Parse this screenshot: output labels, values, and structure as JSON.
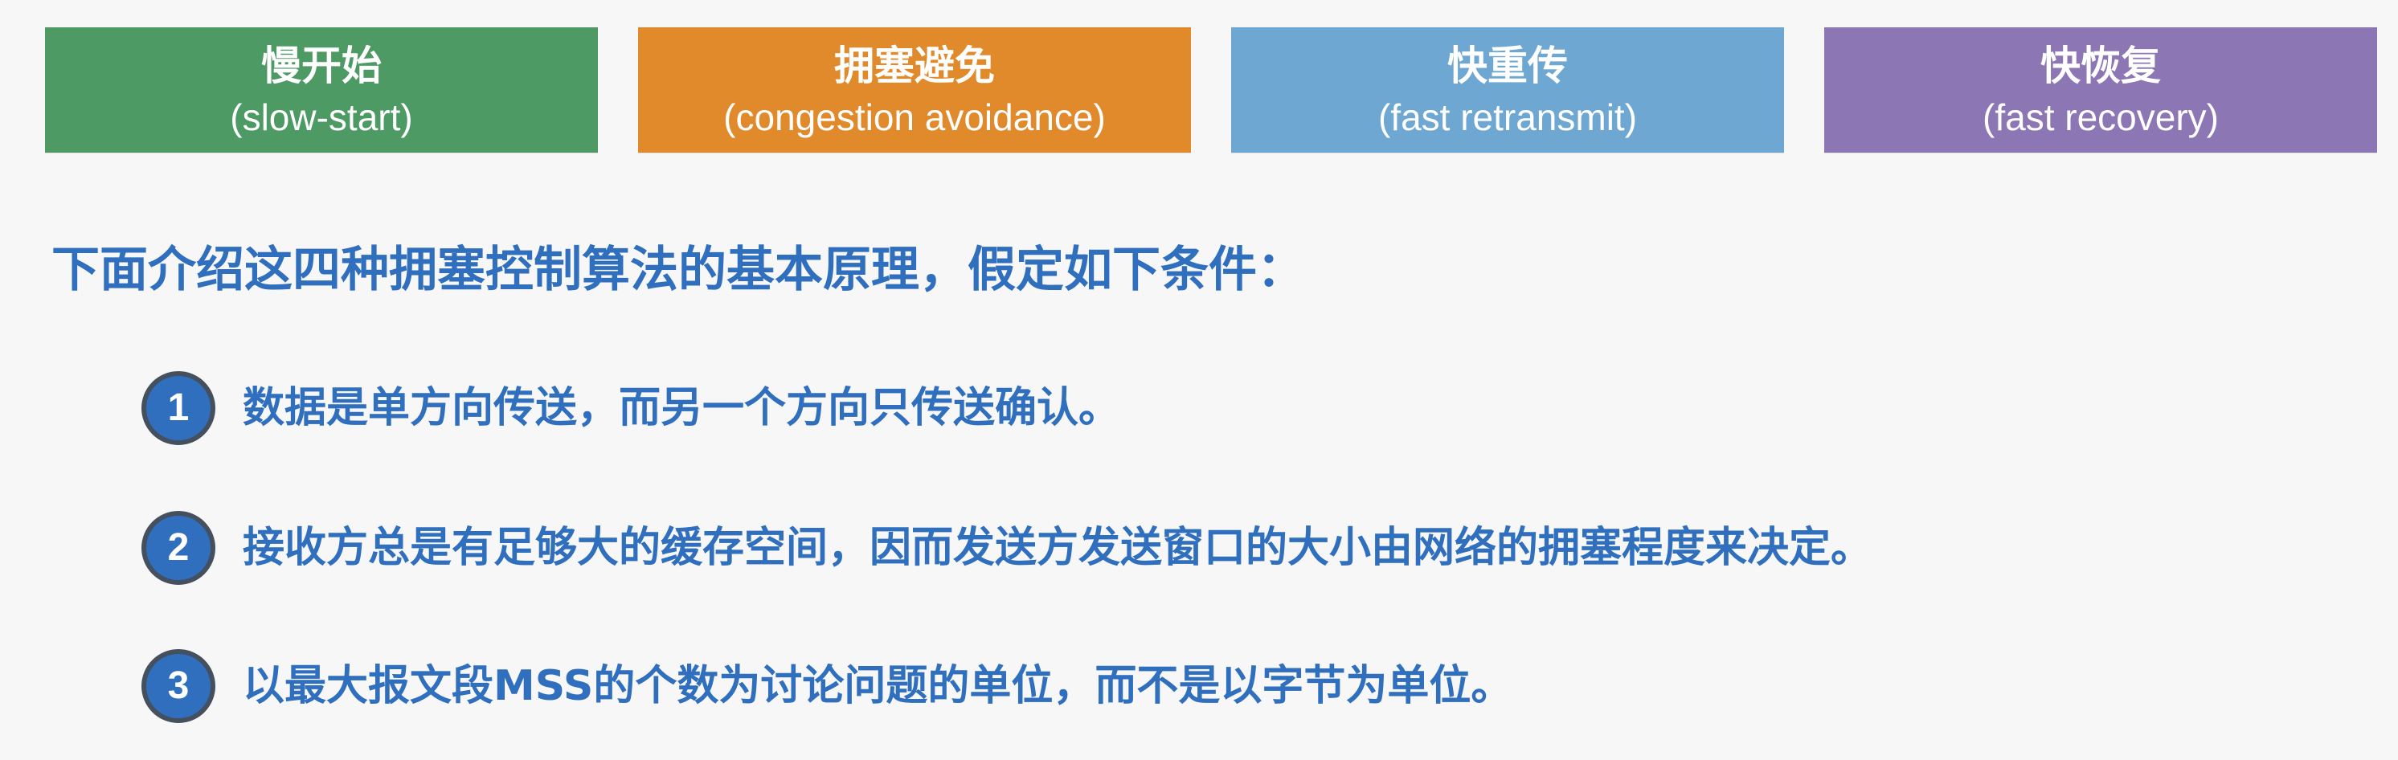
{
  "algorithms": [
    {
      "zh": "慢开始",
      "en": "(slow-start)",
      "color": "#4e9a64"
    },
    {
      "zh": "拥塞避免",
      "en": "(congestion avoidance)",
      "color": "#e08a2c"
    },
    {
      "zh": "快重传",
      "en": "(fast retransmit)",
      "color": "#6ea7d2"
    },
    {
      "zh": "快恢复",
      "en": "(fast recovery)",
      "color": "#8c76b3"
    }
  ],
  "intro": "下面介绍这四种拥塞控制算法的基本原理，假定如下条件：",
  "conditions": [
    {
      "num": "1",
      "text": "数据是单方向传送，而另一个方向只传送确认。"
    },
    {
      "num": "2",
      "text": "接收方总是有足够大的缓存空间，因而发送方发送窗口的大小由网络的拥塞程度来决定。"
    },
    {
      "num": "3",
      "text": "以最大报文段MSS的个数为讨论问题的单位，而不是以字节为单位。"
    }
  ],
  "colors": {
    "accent_text": "#2f6fbe",
    "badge_fill": "#2f6fbe",
    "badge_ring": "#45505e",
    "background": "#f7f7f7"
  }
}
